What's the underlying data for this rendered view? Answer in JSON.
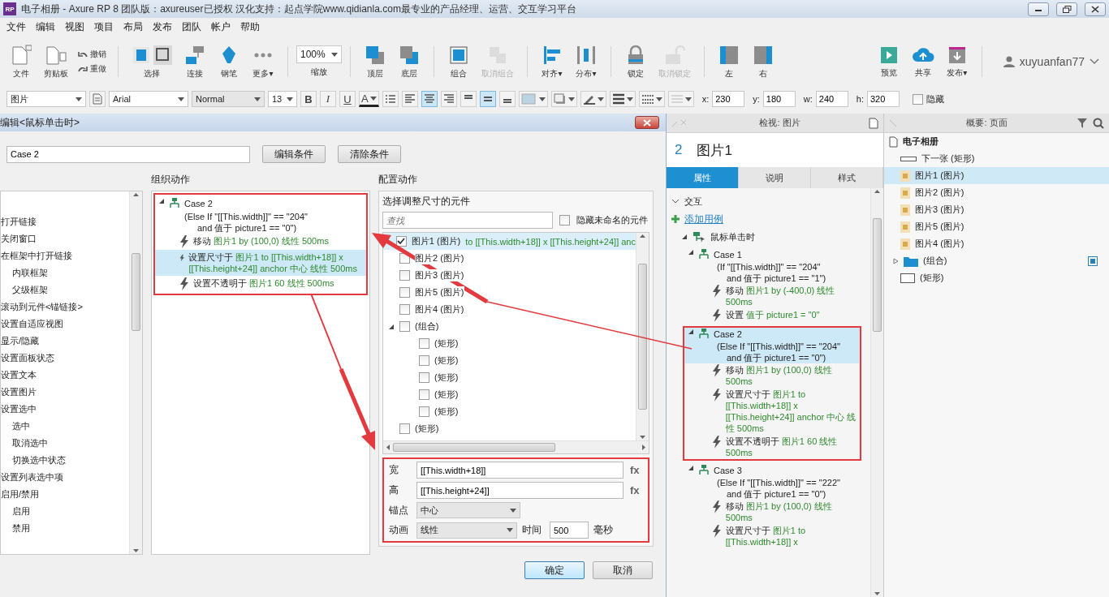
{
  "window": {
    "app_icon": "RP",
    "title": "电子相册 - Axure RP 8 团队版：axureuser已授权 汉化支持：起点学院www.qidianla.com最专业的产品经理、运营、交互学习平台"
  },
  "menu": [
    "文件",
    "编辑",
    "视图",
    "项目",
    "布局",
    "发布",
    "团队",
    "帐户",
    "帮助"
  ],
  "toolbar": {
    "items": [
      {
        "kind": "tool",
        "label": "文件",
        "disabled": false
      },
      {
        "kind": "tool",
        "label": "剪贴板",
        "disabled": false
      },
      {
        "kind": "history",
        "items": [
          "撤销",
          "重做"
        ]
      },
      {
        "kind": "tool",
        "label": "选择",
        "disabled": false
      },
      {
        "kind": "tool",
        "label": "连接",
        "disabled": false
      },
      {
        "kind": "tool",
        "label": "钢笔",
        "disabled": false
      },
      {
        "kind": "tool",
        "label": "更多▾",
        "disabled": false
      },
      {
        "kind": "zoom",
        "value": "100%",
        "label": "缩放"
      },
      {
        "kind": "tool",
        "label": "顶层",
        "disabled": false
      },
      {
        "kind": "tool",
        "label": "底层",
        "disabled": false
      },
      {
        "kind": "tool",
        "label": "组合",
        "disabled": false
      },
      {
        "kind": "tool",
        "label": "取消组合",
        "disabled": true
      },
      {
        "kind": "tool",
        "label": "对齐▾",
        "disabled": false
      },
      {
        "kind": "tool",
        "label": "分布▾",
        "disabled": false
      },
      {
        "kind": "tool",
        "label": "锁定",
        "disabled": false
      },
      {
        "kind": "tool",
        "label": "取消锁定",
        "disabled": true
      },
      {
        "kind": "tool",
        "label": "左",
        "disabled": false
      },
      {
        "kind": "tool",
        "label": "右",
        "disabled": false
      }
    ],
    "actions": [
      {
        "label": "预览"
      },
      {
        "label": "共享"
      },
      {
        "label": "发布▾"
      }
    ],
    "user": "xuyuanfan77"
  },
  "format": {
    "style": "图片",
    "font": "Arial",
    "weight": "Normal",
    "size": "13",
    "bold": "B",
    "italic": "I",
    "underline": "U",
    "text_color": "A",
    "h_align": [
      {
        "selected": false
      },
      {
        "selected": true
      },
      {
        "selected": false
      }
    ],
    "v_align": [
      {
        "selected": false
      },
      {
        "selected": true
      },
      {
        "selected": false
      }
    ],
    "coords": [
      {
        "label": "x:",
        "value": "230"
      },
      {
        "label": "y:",
        "value": "180"
      },
      {
        "label": "w:",
        "value": "240"
      },
      {
        "label": "h:",
        "value": "320"
      }
    ],
    "hidden": {
      "label": "隐藏",
      "checked": false
    }
  },
  "dialog": {
    "title": "编辑<鼠标单击时>",
    "case_name": "Case 2",
    "buttons": [
      "编辑条件",
      "清除条件"
    ],
    "actions_list": [
      {
        "label": "打开链接"
      },
      {
        "label": "关闭窗口"
      },
      {
        "label": "在框架中打开链接",
        "children": [
          {
            "label": "内联框架"
          },
          {
            "label": "父级框架"
          }
        ]
      },
      {
        "label": "滚动到元件<锚链接>"
      },
      {
        "label": "设置自适应视图"
      },
      {
        "label": "显示/隐藏"
      },
      {
        "label": "设置面板状态"
      },
      {
        "label": "设置文本"
      },
      {
        "label": "设置图片"
      },
      {
        "label": "设置选中",
        "children": [
          {
            "label": "选中"
          },
          {
            "label": "取消选中"
          },
          {
            "label": "切换选中状态"
          }
        ]
      },
      {
        "label": "设置列表选中项"
      },
      {
        "label": "启用/禁用",
        "children": [
          {
            "label": "启用"
          },
          {
            "label": "禁用"
          }
        ]
      }
    ],
    "organize": {
      "heading": "组织动作",
      "cases": [
        {
          "name": "Case 2",
          "expanded": true,
          "condition": [
            "(Else If \"[[This.width]]\" == \"204\"",
            "and 值于 picture1 == \"0\")"
          ],
          "actions": [
            {
              "verb": "移动",
              "detail": "图片1 by (100,0) 线性 500ms",
              "selected": false
            },
            {
              "verb": "设置尺寸于",
              "detail": "图片1 to [[This.width+18]] x [[This.height+24]] anchor 中心 线性 500ms",
              "selected": true
            },
            {
              "verb": "设置不透明于",
              "detail": "图片1 60 线性 500ms",
              "selected": false
            }
          ]
        }
      ]
    },
    "configure": {
      "heading": "配置动作",
      "subheading": "选择调整尺寸的元件",
      "search_placeholder": "查找",
      "hide_unnamed": {
        "label": "隐藏未命名的元件",
        "checked": false
      },
      "widgets": [
        {
          "name": "图片1 (图片)",
          "detail": "to [[This.width+18]] x [[This.height+24]] anc",
          "checked": true,
          "selected": true
        },
        {
          "name": "图片2 (图片)",
          "checked": false,
          "selected": false
        },
        {
          "name": "图片3 (图片)",
          "checked": false,
          "selected": false
        },
        {
          "name": "图片5 (图片)",
          "checked": false,
          "selected": false
        },
        {
          "name": "图片4 (图片)",
          "checked": false,
          "selected": false
        },
        {
          "name": "(组合)",
          "checked": false,
          "selected": false,
          "expanded": true,
          "children": [
            {
              "name": "(矩形)",
              "checked": false,
              "selected": false
            },
            {
              "name": "(矩形)",
              "checked": false,
              "selected": false
            },
            {
              "name": "(矩形)",
              "checked": false,
              "selected": false
            },
            {
              "name": "(矩形)",
              "checked": false,
              "selected": false
            },
            {
              "name": "(矩形)",
              "checked": false,
              "selected": false
            }
          ]
        },
        {
          "name": "(矩形)",
          "checked": false,
          "selected": false
        }
      ],
      "width": {
        "label": "宽",
        "value": "[[This.width+18]]",
        "fx": "fx"
      },
      "height": {
        "label": "高",
        "value": "[[This.height+24]]",
        "fx": "fx"
      },
      "anchor": {
        "label": "锚点",
        "value": "中心"
      },
      "animation": {
        "label": "动画",
        "value": "线性"
      },
      "time": {
        "label": "时间",
        "value": "500",
        "unit": "毫秒"
      }
    },
    "footer_buttons": [
      "确定",
      "取消"
    ]
  },
  "inspector": {
    "title": "检视: 图片",
    "number": "2",
    "name": "图片1",
    "tabs": [
      {
        "label": "属性",
        "selected": true
      },
      {
        "label": "说明",
        "selected": false
      },
      {
        "label": "样式",
        "selected": false
      }
    ],
    "section": "交互",
    "section_expanded": true,
    "add_case": "添加用例",
    "events": [
      {
        "name": "鼠标单击时",
        "expanded": true,
        "cases": [
          {
            "name": "Case 1",
            "selected": false,
            "condition": [
              "(If \"[[This.width]]\" == \"204\"",
              "and 值于 picture1 == \"1\")"
            ],
            "actions": [
              {
                "verb": "移动",
                "detail": "图片1 by (-400,0) 线性 500ms"
              },
              {
                "verb": "设置",
                "detail": "值于 picture1 = \"0\""
              }
            ]
          },
          {
            "name": "Case 2",
            "selected": true,
            "condition": [
              "(Else If \"[[This.width]]\" == \"204\"",
              "and 值于 picture1 == \"0\")"
            ],
            "actions": [
              {
                "verb": "移动",
                "detail": "图片1 by (100,0) 线性 500ms"
              },
              {
                "verb": "设置尺寸于",
                "detail": "图片1 to [[This.width+18]] x [[This.height+24]] anchor 中心 线性 500ms"
              },
              {
                "verb": "设置不透明于",
                "detail": "图片1 60 线性 500ms"
              }
            ]
          },
          {
            "name": "Case 3",
            "selected": false,
            "condition": [
              "(Else If \"[[This.width]]\" == \"222\"",
              "and 值于 picture1 == \"0\")"
            ],
            "actions": [
              {
                "verb": "移动",
                "detail": "图片1 by (100,0) 线性 500ms"
              },
              {
                "verb": "设置尺寸于",
                "detail": "图片1 to [[This.width+18]] x"
              }
            ]
          }
        ]
      }
    ]
  },
  "outline": {
    "title": "概要: 页面",
    "page": "电子相册",
    "items": [
      {
        "name": "下一张 (矩形)",
        "kind": "shape",
        "selected": false
      },
      {
        "name": "图片1 (图片)",
        "kind": "image",
        "selected": true
      },
      {
        "name": "图片2 (图片)",
        "kind": "image",
        "selected": false
      },
      {
        "name": "图片3 (图片)",
        "kind": "image",
        "selected": false
      },
      {
        "name": "图片5 (图片)",
        "kind": "image",
        "selected": false
      },
      {
        "name": "图片4 (图片)",
        "kind": "image",
        "selected": false
      },
      {
        "name": "(组合)",
        "kind": "group",
        "selected": false,
        "expanded": false
      },
      {
        "name": "(矩形)",
        "kind": "rect",
        "selected": false
      }
    ]
  }
}
